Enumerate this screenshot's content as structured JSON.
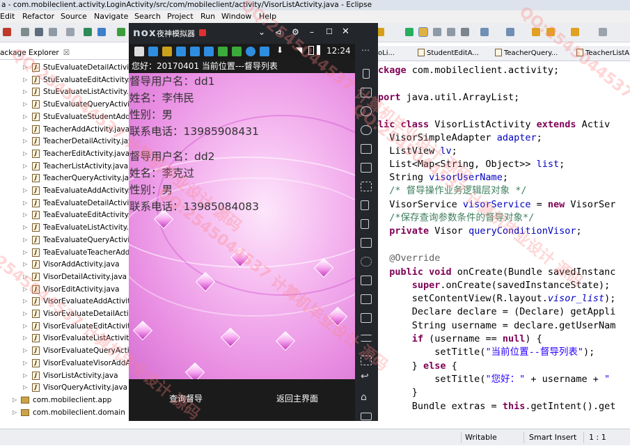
{
  "window": {
    "title": "a - com.mobileclient.activity.LoginActivity/src/com/mobileclient/activity/VisorListActivity.java - Eclipse"
  },
  "menu": [
    "Edit",
    "Refactor",
    "Source",
    "Navigate",
    "Search",
    "Project",
    "Run",
    "Window",
    "Help"
  ],
  "package_explorer": {
    "tab_label": "ackage Explorer",
    "files": [
      "StuEvaluateDetailActivity.java",
      "StuEvaluateEditActivity.java",
      "StuEvaluateListActivity.java",
      "StuEvaluateQueryActivity.java",
      "StuEvaluateStudentAddActivity.java",
      "TeacherAddActivity.java",
      "TeacherDetailActivity.java",
      "TeacherEditActivity.java",
      "TeacherListActivity.java",
      "TeacherQueryActivity.java",
      "TeaEvaluateAddActivity.java",
      "TeaEvaluateDetailActivity.java",
      "TeaEvaluateEditActivity.java",
      "TeaEvaluateListActivity.java",
      "TeaEvaluateQueryActivity.java",
      "TeaEvaluateTeacherAddActivity.java",
      "VisorAddActivity.java",
      "VisorDetailActivity.java",
      "VisorEditActivity.java",
      "VisorEvaluateAddActivity.java",
      "VisorEvaluateDetailActivity.java",
      "VisorEvaluateEditActivity.java",
      "VisorEvaluateListActivity.java",
      "VisorEvaluateQueryActivity.java",
      "VisorEvaluateVisorAddActivity.java",
      "VisorListActivity.java",
      "VisorQueryActivity.java"
    ],
    "packages": [
      "com.mobileclient.app",
      "com.mobileclient.domain"
    ]
  },
  "editor_tabs": [
    "oLi...",
    "StudentEditA...",
    "TeacherQuery...",
    "TeacherListA..."
  ],
  "emulator": {
    "name": "夜神模拟器",
    "logo": "nox",
    "time": "12:24",
    "app_title": "您好：20170401   当前位置---督导列表",
    "records": [
      {
        "user": "督导用户名：dd1",
        "name": "姓名：李伟民",
        "gender": "性别：男",
        "phone": "联系电话：13985908431"
      },
      {
        "user": "督导用户名：dd2",
        "name": "姓名：李克过",
        "gender": "性别：男",
        "phone": "联系电话：13985084083"
      }
    ],
    "query_button": "查询督导",
    "back_button": "返回主界面"
  },
  "status": {
    "writable": "Writable",
    "insert": "Smart Insert",
    "position": "1 : 1"
  },
  "watermark": "QQ:2545044537  计算机毕业设计 源码"
}
